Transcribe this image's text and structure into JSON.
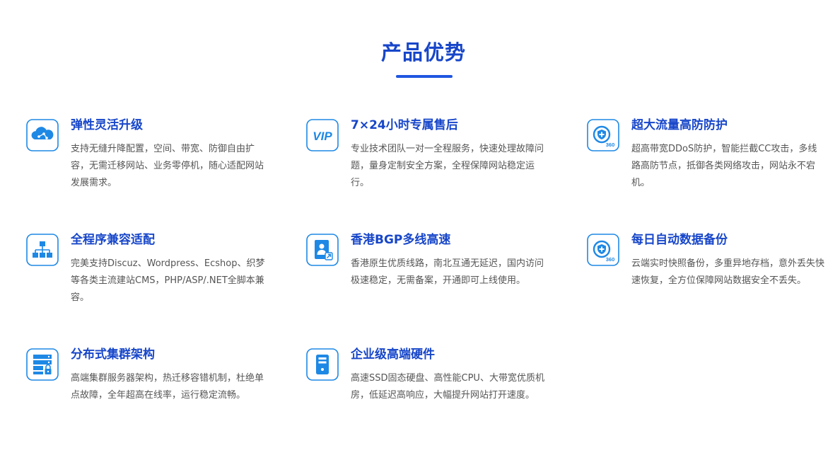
{
  "section": {
    "title": "产品优势"
  },
  "accent_color": "#1746c9",
  "features": [
    {
      "icon": "cloud-network-icon",
      "title": "弹性灵活升级",
      "desc": "支持无缝升降配置，空间、带宽、防御自由扩容，无需迁移网站、业务零停机，随心适配网站发展需求。"
    },
    {
      "icon": "vip-icon",
      "icon_text": "VIP",
      "title": "7×24小时专属售后",
      "desc": "专业技术团队一对一全程服务，快速处理故障问题，量身定制安全方案，全程保障网站稳定运行。"
    },
    {
      "icon": "shield-360-icon",
      "icon_text": "360",
      "title": "超大流量高防防护",
      "desc": "超高带宽DDoS防护，智能拦截CC攻击，多线路高防节点，抵御各类网络攻击，网站永不宕机。"
    },
    {
      "icon": "hierarchy-icon",
      "title": "全程序兼容适配",
      "desc": "完美支持Discuz、Wordpress、Ecshop、织梦等各类主流建站CMS，PHP/ASP/.NET全脚本兼容。"
    },
    {
      "icon": "document-user-icon",
      "title": "香港BGP多线高速",
      "desc": "香港原生优质线路，南北互通无延迟，国内访问极速稳定，无需备案，开通即可上线使用。"
    },
    {
      "icon": "shield-360-icon",
      "icon_text": "360",
      "title": "每日自动数据备份",
      "desc": "云端实时快照备份，多重异地存档，意外丢失快速恢复，全方位保障网站数据安全不丢失。"
    },
    {
      "icon": "server-lock-icon",
      "title": "分布式集群架构",
      "desc": "高端集群服务器架构，热迁移容错机制，杜绝单点故障，全年超高在线率，运行稳定流畅。"
    },
    {
      "icon": "server-hardware-icon",
      "title": "企业级高端硬件",
      "desc": "高速SSD固态硬盘、高性能CPU、大带宽优质机房，低延迟高响应，大幅提升网站打开速度。"
    }
  ]
}
